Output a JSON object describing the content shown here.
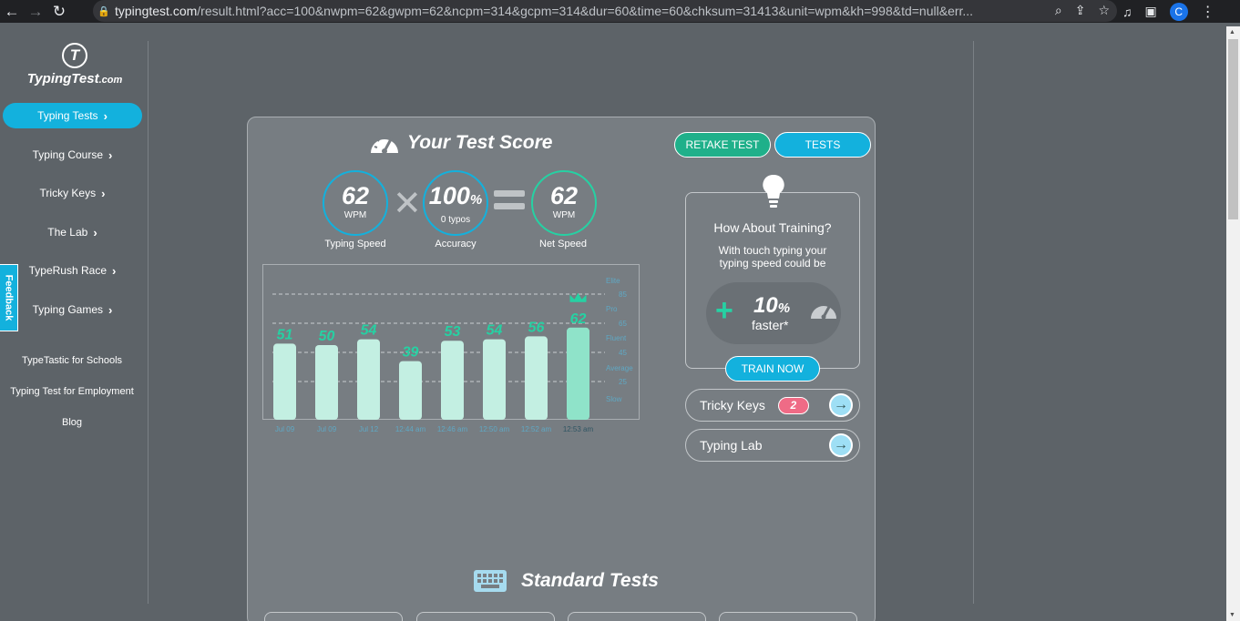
{
  "browser": {
    "url_host": "typingtest.com",
    "url_rest": "/result.html?acc=100&nwpm=62&gwpm=62&ncpm=314&gcpm=314&dur=60&time=60&chksum=31413&unit=wpm&kh=998&td=null&err...",
    "profile_initial": "C"
  },
  "sidebar": {
    "logo_text": "TypingTest",
    "logo_suffix": ".com",
    "logo_mark": "T",
    "nav": [
      {
        "label": "Typing Tests",
        "active": true
      },
      {
        "label": "Typing Course"
      },
      {
        "label": "Tricky Keys"
      },
      {
        "label": "The Lab"
      },
      {
        "label": "TypeRush Race"
      },
      {
        "label": "Typing Games"
      }
    ],
    "links": [
      "TypeTastic for Schools",
      "Typing Test for Employment",
      "Blog"
    ],
    "feedback": "Feedback"
  },
  "score": {
    "title": "Your Test Score",
    "typing_speed": {
      "value": "62",
      "unit": "WPM",
      "label": "Typing Speed"
    },
    "accuracy": {
      "value": "100",
      "suffix": "%",
      "sub": "0  typos",
      "label": "Accuracy"
    },
    "net_speed": {
      "value": "62",
      "unit": "WPM",
      "label": "Net Speed"
    }
  },
  "buttons": {
    "retake": "RETAKE TEST",
    "tests": "TESTS"
  },
  "chart_data": {
    "type": "bar",
    "categories": [
      "Jul 09",
      "Jul 09",
      "Jul 12",
      "12:44 am",
      "12:46 am",
      "12:50 am",
      "12:52 am",
      "12:53 am"
    ],
    "values": [
      51,
      50,
      54,
      39,
      53,
      54,
      56,
      62
    ],
    "data_labels": [
      "51",
      "50",
      "54",
      "39",
      "53",
      "54",
      "56",
      "62"
    ],
    "highlight_index": 7,
    "ylim": [
      0,
      105
    ],
    "y_ticks": [
      25,
      45,
      65,
      85
    ],
    "right_labels": [
      "Elite",
      "Pro",
      "Fluent",
      "Average",
      "Slow"
    ],
    "grid": true,
    "colors": {
      "bar": "#c3efe2",
      "bar_highlight": "#8fe3c9",
      "label": "#26d1a3",
      "axis_text": "#5fa8c4"
    }
  },
  "training": {
    "title": "How About Training?",
    "text": "With touch typing your typing speed could be",
    "percent": "10",
    "percent_suffix": "%",
    "faster": "faster*",
    "button": "TRAIN NOW"
  },
  "links": {
    "tricky_keys": {
      "label": "Tricky Keys",
      "badge": "2"
    },
    "typing_lab": {
      "label": "Typing Lab"
    }
  },
  "standard_tests": {
    "title": "Standard Tests"
  },
  "colors": {
    "accent_blue": "#13b1dd",
    "accent_green": "#26d1a3",
    "panel": "#777d82",
    "page": "#5d6368"
  }
}
